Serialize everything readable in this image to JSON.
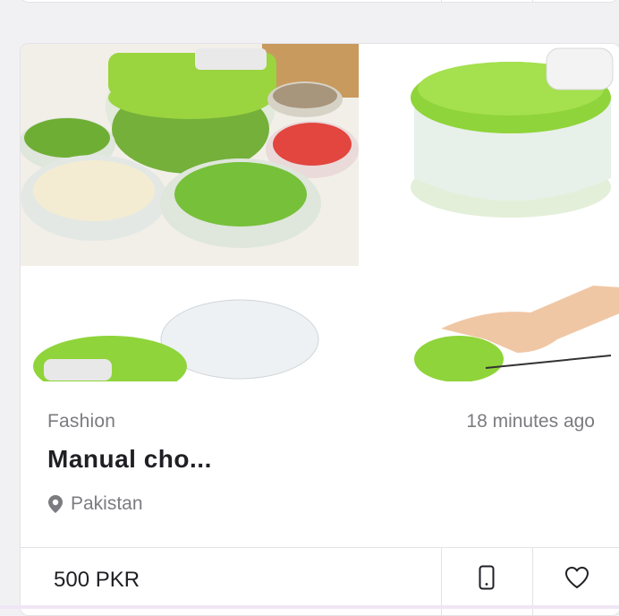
{
  "listing": {
    "category": "Fashion",
    "time_ago": "18 minutes ago",
    "title": "Manual cho...",
    "location": "Pakistan",
    "price": "500 PKR",
    "image_alt": "Manual chopper product collage"
  },
  "icons": {
    "location": "map-pin-icon",
    "phone": "phone-icon",
    "favorite": "heart-icon"
  },
  "colors": {
    "accent_green": "#8fd43a",
    "text_dark": "#1f1f24",
    "text_muted": "#7b7b80",
    "border": "#e3e3e6"
  }
}
